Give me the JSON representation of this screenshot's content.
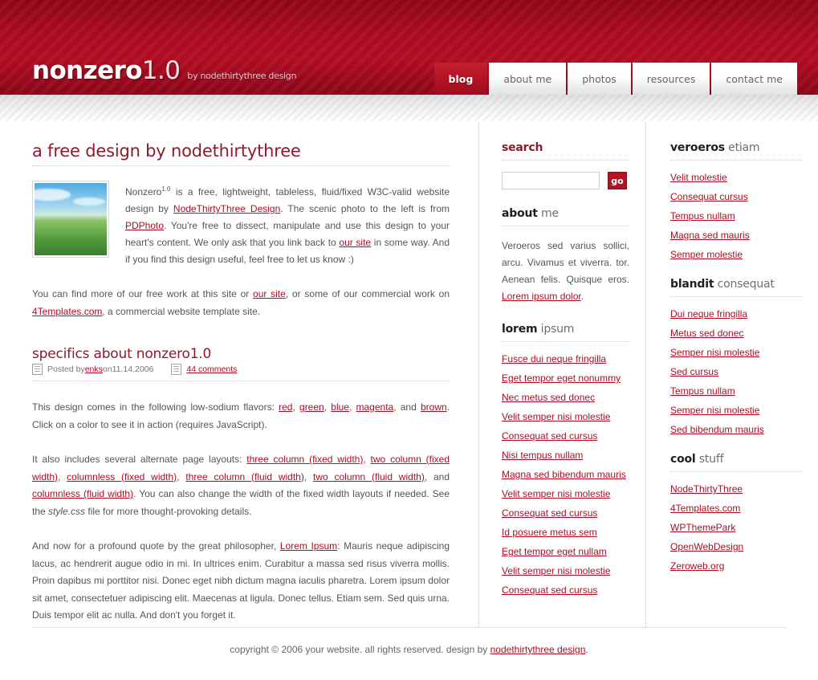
{
  "header": {
    "logo_main": "nonzero",
    "logo_version": "1.0",
    "logo_sub": "by nodethirtythree design",
    "nav": [
      {
        "label": "blog",
        "active": true
      },
      {
        "label": "about me",
        "active": false
      },
      {
        "label": "photos",
        "active": false
      },
      {
        "label": "resources",
        "active": false
      },
      {
        "label": "contact me",
        "active": false
      }
    ]
  },
  "main": {
    "page_title": "a free design by nodethirtythree",
    "intro": {
      "part1": "Nonzero",
      "sup": "1.0",
      "part2": " is a free, lightweight, tableless, fluid/fixed W3C-valid website design by ",
      "link1": "NodeThirtyThree Design",
      "part3": ". The scenic photo to the left is from ",
      "link2": "PDPhoto",
      "part4": ". You're free to dissect, manipulate and use this design to your heart's content. We only ask that you link back to ",
      "link3": "our site",
      "part5": " in some way. And if you find this design useful, feel free to let us know :)"
    },
    "paragraph_freework": {
      "part1": "You can find more of our free work at this site or ",
      "link1": "our site",
      "part2": ", or some of our commercial work on ",
      "link2": "4Templates.com",
      "part3": ", a commercial website template site."
    },
    "post": {
      "title": "specifics about nonzero1.0",
      "meta_posted_prefix": "Posted by ",
      "meta_author": "enks",
      "meta_date_prefix": " on ",
      "meta_date": "11.14.2006",
      "meta_comments": "44 comments",
      "flavors": {
        "lead": "This design comes in the following low-sodium flavors: ",
        "colors": [
          "red",
          "green",
          "blue",
          "magenta",
          "brown"
        ],
        "tail": ". Click on a color to see it in action (requires JavaScript)."
      },
      "layouts": {
        "lead": "It also includes several alternate page layouts: ",
        "links": [
          "three column (fixed width)",
          "two column (fixed width)",
          "columnless (fixed width)",
          "three column (fluid width)",
          "two column (fluid width)",
          "columnless (fluid width)"
        ],
        "tail_a": ". You can also change the width of the fixed width layouts if needed. See the ",
        "tail_em": "style.css",
        "tail_b": " file for more thought-provoking details."
      },
      "quote": {
        "lead": "And now for a profound quote by the great philosopher, ",
        "link": "Lorem Ipsum",
        "body": ": Mauris neque adipiscing lacus, ac hendrerit augue odio in mi. In ultrices enim. Curabitur a massa sed risus viverra mollis. Proin dapibus mi porttitor nisi. Donec eget nibh dictum magna iaculis pharetra. Lorem ipsum dolor sit amet, consectetuer adipiscing elit. Maecenas at ligula. Donec tellus. Etiam sem. Sed quis urna. Duis tempor elit ac nulla. And don't you forget it."
      }
    }
  },
  "sidebar_mid": {
    "search": {
      "title": "search",
      "value": "",
      "placeholder": "",
      "go_label": "go"
    },
    "about": {
      "title_bold": "about",
      "title_rest": " me",
      "text_part1": "Veroeros sed varius sollici, arcu. Vivamus et viverra. tor. Aenean felis. Quisque eros. ",
      "link": "Lorem ipsum dolor",
      "text_part2": "."
    },
    "lorem": {
      "title_bold": "lorem",
      "title_rest": " ipsum",
      "items": [
        "Fusce dui neque fringilla",
        "Eget tempor eget nonummy",
        "Nec metus sed donec",
        "Velit semper nisi molestie",
        "Consequat sed cursus",
        "Nisi tempus nullam",
        "Magna sed bibendum mauris",
        "Velit semper nisi molestie",
        "Consequat sed cursus",
        "Id posuere metus sem",
        "Eget tempor eget nullam",
        "Velit semper nisi molestie",
        "Consequat sed cursus"
      ]
    }
  },
  "sidebar_right": {
    "veroeros": {
      "title_bold": "veroeros",
      "title_rest": " etiam",
      "items": [
        "Velit molestie",
        "Consequat cursus",
        "Tempus nullam",
        "Magna sed mauris",
        "Semper molestie"
      ]
    },
    "blandit": {
      "title_bold": "blandit",
      "title_rest": " consequat",
      "items": [
        "Dui neque fringilla",
        "Metus sed donec",
        "Semper nisi molestie",
        "Sed cursus",
        "Tempus nullam",
        "Semper nisi molestie",
        "Sed bibendum mauris"
      ]
    },
    "cool": {
      "title_bold": "cool",
      "title_rest": " stuff",
      "items": [
        "NodeThirtyThree",
        "4Templates.com",
        "WPThemePark",
        "OpenWebDesign",
        "Zeroweb.org"
      ]
    }
  },
  "footer": {
    "text_before": "copyright © 2006 your website. all rights reserved. design by ",
    "link": "nodethirtythree design",
    "text_after": "."
  },
  "colors": {
    "brand_red": "#b00c22",
    "header_red_dark": "#8d0618",
    "heading_maroon": "#8e1b2c"
  }
}
